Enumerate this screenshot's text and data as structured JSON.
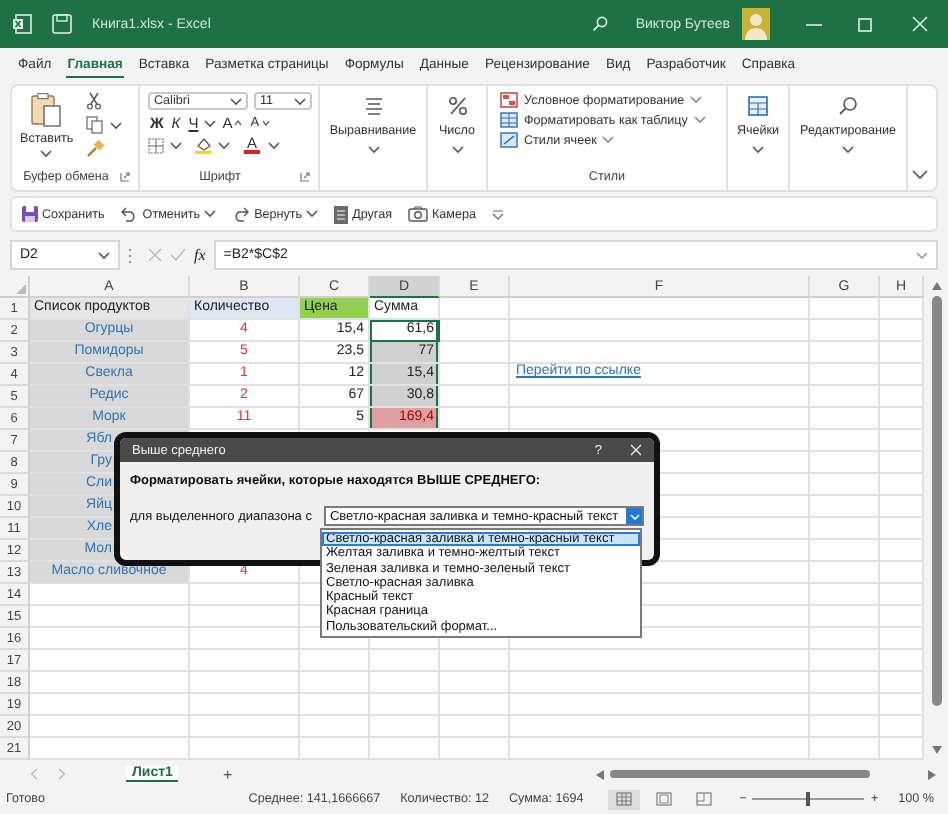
{
  "window": {
    "title": "Книга1.xlsx - Excel",
    "user": "Виктор Бутеев"
  },
  "tabs": [
    {
      "label": "Файл",
      "selected": false
    },
    {
      "label": "Главная",
      "selected": true
    },
    {
      "label": "Вставка",
      "selected": false
    },
    {
      "label": "Разметка страницы",
      "selected": false
    },
    {
      "label": "Формулы",
      "selected": false
    },
    {
      "label": "Данные",
      "selected": false
    },
    {
      "label": "Рецензирование",
      "selected": false
    },
    {
      "label": "Вид",
      "selected": false
    },
    {
      "label": "Разработчик",
      "selected": false
    },
    {
      "label": "Справка",
      "selected": false
    }
  ],
  "ribbon": {
    "groups": [
      {
        "kind": "clipboard",
        "label": "Буфер обмена",
        "paste": "Вставить"
      },
      {
        "kind": "font",
        "label": "Шрифт",
        "font": "Calibri",
        "size": "11",
        "bold": "Ж",
        "italic": "К",
        "underline": "Ч",
        "grow": "A",
        "shrink": "A",
        "font_color": "A"
      },
      {
        "kind": "alignment",
        "button": "Выравнивание"
      },
      {
        "kind": "number",
        "button": "Число"
      },
      {
        "kind": "styles",
        "label": "Стили",
        "items": [
          "Условное форматирование",
          "Форматировать как таблицу",
          "Стили ячеек"
        ]
      },
      {
        "kind": "cells",
        "button": "Ячейки"
      },
      {
        "kind": "editing",
        "button": "Редактирование"
      }
    ]
  },
  "quick_access": [
    {
      "kind": "save",
      "label": "Сохранить",
      "dropdown": false
    },
    {
      "kind": "undo",
      "label": "Отменить",
      "dropdown": true
    },
    {
      "kind": "redo",
      "label": "Вернуть",
      "dropdown": true
    },
    {
      "kind": "other",
      "label": "Другая",
      "dropdown": false
    },
    {
      "kind": "camera",
      "label": "Камера",
      "dropdown": false
    }
  ],
  "formula_bar": {
    "name_box": "D2",
    "fx": "fx",
    "formula": "=B2*$C$2"
  },
  "sheet": {
    "columns": [
      "A",
      "B",
      "C",
      "D",
      "E",
      "F",
      "G",
      "H"
    ],
    "rows": [
      {
        "number": "1",
        "cells": [
          {
            "text": "Список продуктов",
            "color": "#e7e6e6"
          },
          {
            "text": "Количество",
            "color": "#dde6f2"
          },
          {
            "text": "Цена",
            "color": "#92d050"
          },
          {
            "text": "Сумма",
            "color": "#ffffff",
            "selected": false
          }
        ]
      },
      {
        "number": "2",
        "cells": [
          {
            "text": "Огурцы"
          },
          {
            "text": "4"
          },
          {
            "text": "15,4"
          },
          {
            "text": "61,6",
            "selected": true,
            "active": true,
            "above_average": false
          }
        ]
      },
      {
        "number": "3",
        "cells": [
          {
            "text": "Помидоры"
          },
          {
            "text": "5"
          },
          {
            "text": "23,5"
          },
          {
            "text": "77",
            "selected": true,
            "active": false,
            "above_average": false
          }
        ]
      },
      {
        "number": "4",
        "cells": [
          {
            "text": "Свекла"
          },
          {
            "text": "1"
          },
          {
            "text": "12"
          },
          {
            "text": "15,4",
            "selected": true,
            "active": false,
            "above_average": false
          }
        ],
        "link": "Перейти по ссылке"
      },
      {
        "number": "5",
        "cells": [
          {
            "text": "Редис"
          },
          {
            "text": "2"
          },
          {
            "text": "67"
          },
          {
            "text": "30,8",
            "selected": true,
            "active": false,
            "above_average": false
          }
        ]
      },
      {
        "number": "6",
        "cells": [
          {
            "text": "Морк"
          },
          {
            "text": "11"
          },
          {
            "text": "5"
          },
          {
            "text": "169,4",
            "selected": true,
            "active": false,
            "above_average": true
          }
        ]
      },
      {
        "number": "7",
        "cells": [
          {
            "text": "Ябл"
          }
        ]
      },
      {
        "number": "8",
        "cells": [
          {
            "text": "Гру"
          }
        ]
      },
      {
        "number": "9",
        "cells": [
          {
            "text": "Сли"
          }
        ]
      },
      {
        "number": "10",
        "cells": [
          {
            "text": "Яйц"
          }
        ]
      },
      {
        "number": "11",
        "cells": [
          {
            "text": "Хле"
          }
        ]
      },
      {
        "number": "12",
        "cells": [
          {
            "text": "Мол"
          }
        ]
      },
      {
        "number": "13",
        "cells": [
          {
            "text": "Масло сливочное"
          },
          {
            "text": "4"
          }
        ]
      },
      {
        "number": "14",
        "cells": []
      },
      {
        "number": "15",
        "cells": []
      },
      {
        "number": "16",
        "cells": []
      },
      {
        "number": "17",
        "cells": []
      },
      {
        "number": "18",
        "cells": []
      },
      {
        "number": "19",
        "cells": []
      },
      {
        "number": "20",
        "cells": []
      },
      {
        "number": "21",
        "cells": []
      }
    ]
  },
  "dialog": {
    "title": "Выше среднего",
    "help": "?",
    "prompt": "Форматировать ячейки, которые находятся ВЫШЕ СРЕДНЕГО:",
    "range_label": "для выделенного диапазона с",
    "value": "Светло-красная заливка и темно-красный текст",
    "options": [
      {
        "label": "Светло-красная заливка и темно-красный текст",
        "selected": true
      },
      {
        "label": "Желтая заливка и темно-желтый текст",
        "selected": false
      },
      {
        "label": "Зеленая заливка и темно-зеленый текст",
        "selected": false
      },
      {
        "label": "Светло-красная заливка",
        "selected": false
      },
      {
        "label": "Красный текст",
        "selected": false
      },
      {
        "label": "Красная граница",
        "selected": false
      },
      {
        "label": "Пользовательский формат...",
        "selected": false
      }
    ]
  },
  "sheet_tabs": [
    {
      "label": "Лист1",
      "selected": true
    }
  ],
  "add_sheet": "+",
  "status_bar": {
    "status": "Готово",
    "average": "Среднее: 141,1666667",
    "count": "Количество: 12",
    "sum": "Сумма: 1694",
    "views": [
      {
        "kind": "normal",
        "selected": true
      },
      {
        "kind": "page_layout",
        "selected": false
      },
      {
        "kind": "page_break",
        "selected": false
      }
    ],
    "zoom_out": "−",
    "zoom_in": "+",
    "zoom": {
      "level": 0.5
    },
    "zoom_label": "100 %"
  }
}
